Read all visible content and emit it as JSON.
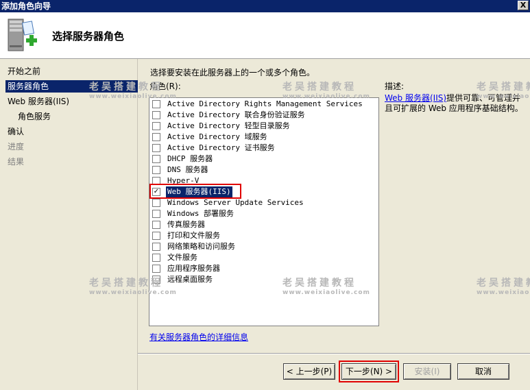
{
  "window": {
    "title": "添加角色向导",
    "close_glyph": "X"
  },
  "header": {
    "title": "选择服务器角色",
    "icon": "server-add-icon"
  },
  "nav": {
    "items": [
      {
        "label": "开始之前",
        "state": "normal"
      },
      {
        "label": "服务器角色",
        "state": "selected"
      },
      {
        "label": "Web 服务器(IIS)",
        "state": "normal"
      },
      {
        "label": "角色服务",
        "state": "normal"
      },
      {
        "label": "确认",
        "state": "normal"
      },
      {
        "label": "进度",
        "state": "disabled"
      },
      {
        "label": "结果",
        "state": "disabled"
      }
    ]
  },
  "main": {
    "instruction": "选择要安装在此服务器上的一个或多个角色。",
    "roles_label": "角色(R):",
    "roles": [
      {
        "label": "Active Directory Rights Management Services",
        "checked": false
      },
      {
        "label": "Active Directory 联合身份验证服务",
        "checked": false
      },
      {
        "label": "Active Directory 轻型目录服务",
        "checked": false
      },
      {
        "label": "Active Directory 域服务",
        "checked": false
      },
      {
        "label": "Active Directory 证书服务",
        "checked": false
      },
      {
        "label": "DHCP 服务器",
        "checked": false
      },
      {
        "label": "DNS 服务器",
        "checked": false
      },
      {
        "label": "Hyper-V",
        "checked": false
      },
      {
        "label": "Web 服务器(IIS)",
        "checked": true
      },
      {
        "label": "Windows Server Update Services",
        "checked": false
      },
      {
        "label": "Windows 部署服务",
        "checked": false
      },
      {
        "label": "传真服务器",
        "checked": false
      },
      {
        "label": "打印和文件服务",
        "checked": false
      },
      {
        "label": "网络策略和访问服务",
        "checked": false
      },
      {
        "label": "文件服务",
        "checked": false
      },
      {
        "label": "应用程序服务器",
        "checked": false
      },
      {
        "label": "远程桌面服务",
        "checked": false
      }
    ],
    "description_label": "描述:",
    "description_link": "Web 服务器(IIS)",
    "description_text": "提供可靠、可管理并且可扩展的 Web 应用程序基础结构。",
    "more_info_link": "有关服务器角色的详细信息"
  },
  "buttons": {
    "back": "< 上一步(P)",
    "next": "下一步(N) >",
    "install": "安装(I)",
    "cancel": "取消"
  },
  "watermark": {
    "title": "老吴搭建教程",
    "url": "www.weixiaolive.com"
  },
  "colors": {
    "titlebar": "#0a246a",
    "selection": "#0a246a",
    "highlight_box": "#e00000",
    "link": "#0000ee"
  }
}
